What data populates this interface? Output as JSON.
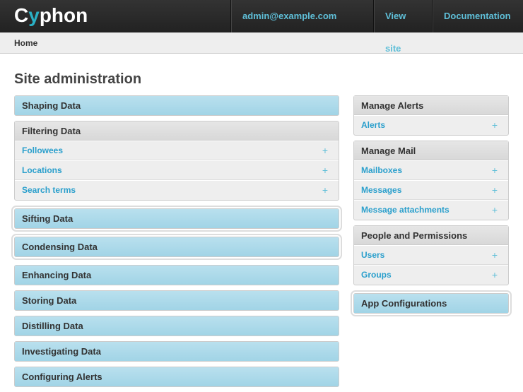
{
  "header": {
    "logo": "Cyphon",
    "user": "admin@example.com",
    "view_site": "View site",
    "documentation": "Documentation"
  },
  "breadcrumb": "Home",
  "title": "Site administration",
  "left": [
    {
      "title": "Shaping Data",
      "style": "blue",
      "items": []
    },
    {
      "title": "Filtering Data",
      "style": "gray",
      "items": [
        "Followees",
        "Locations",
        "Search terms"
      ]
    },
    {
      "title": "Sifting Data",
      "style": "blue",
      "ring": true,
      "items": []
    },
    {
      "title": "Condensing Data",
      "style": "blue",
      "ring": true,
      "items": []
    },
    {
      "title": "Enhancing Data",
      "style": "blue",
      "items": []
    },
    {
      "title": "Storing Data",
      "style": "blue",
      "items": []
    },
    {
      "title": "Distilling Data",
      "style": "blue",
      "items": []
    },
    {
      "title": "Investigating Data",
      "style": "blue",
      "items": []
    },
    {
      "title": "Configuring Alerts",
      "style": "blue",
      "items": []
    }
  ],
  "right": [
    {
      "title": "Manage Alerts",
      "style": "gray",
      "items": [
        "Alerts"
      ]
    },
    {
      "title": "Manage Mail",
      "style": "gray",
      "items": [
        "Mailboxes",
        "Messages",
        "Message attachments"
      ]
    },
    {
      "title": "People and Permissions",
      "style": "gray",
      "items": [
        "Users",
        "Groups"
      ]
    },
    {
      "title": "App Configurations",
      "style": "blue",
      "ring": true,
      "items": []
    }
  ],
  "add_symbol": "+"
}
